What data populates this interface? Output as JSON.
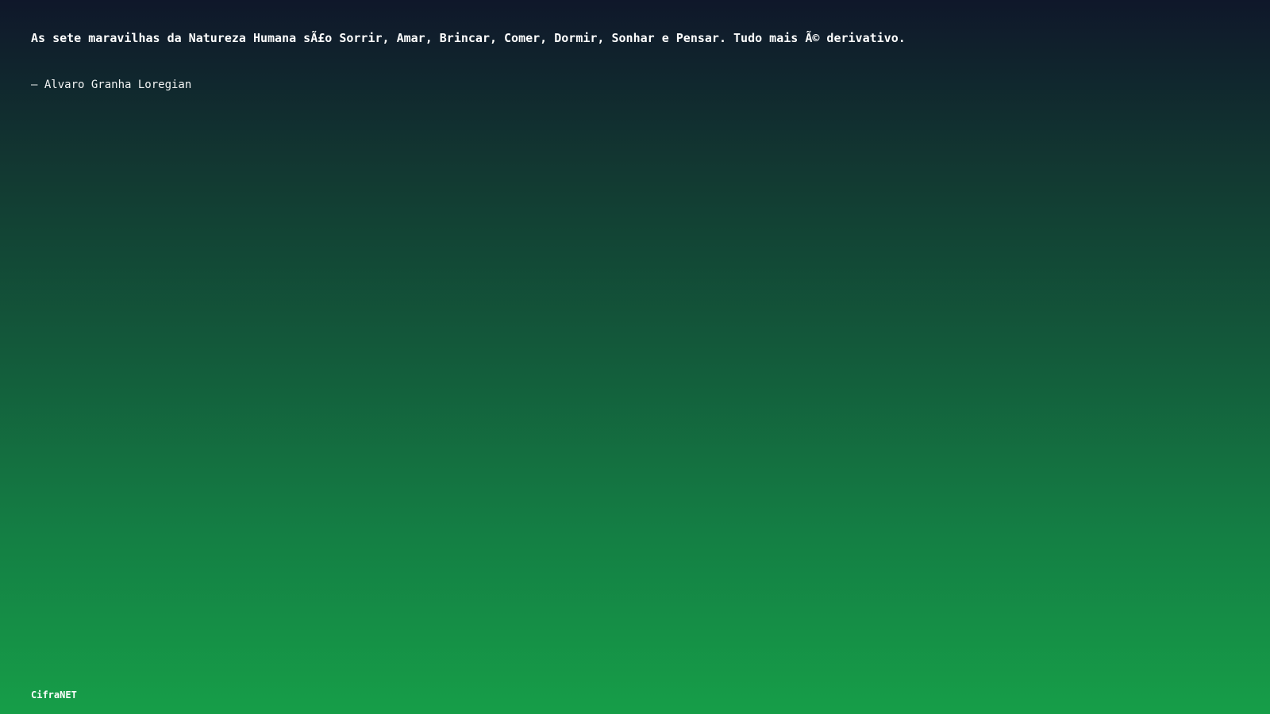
{
  "quote": {
    "text": "As sete maravilhas da Natureza Humana sÃ£o Sorrir, Amar, Brincar, Comer, Dormir, Sonhar e Pensar. Tudo mais Ã© derivativo."
  },
  "author": {
    "text": "– Alvaro Granha Loregian"
  },
  "brand": {
    "label": "CifraNET"
  },
  "colors": {
    "background_top": "#0f172a",
    "background_bottom": "#169e48",
    "text": "#ffffff"
  }
}
